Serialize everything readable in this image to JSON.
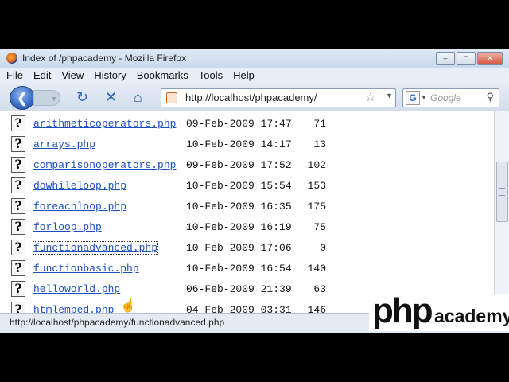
{
  "window": {
    "title": "Index of /phpacademy - Mozilla Firefox"
  },
  "menu": [
    "File",
    "Edit",
    "View",
    "History",
    "Bookmarks",
    "Tools",
    "Help"
  ],
  "nav": {
    "url": "http://localhost/phpacademy/",
    "search_placeholder": "Google",
    "search_engine_letter": "G"
  },
  "files": [
    {
      "name": "arithmeticoperators.php",
      "date": "09-Feb-2009 17:47",
      "size": "71"
    },
    {
      "name": "arrays.php",
      "date": "10-Feb-2009 14:17",
      "size": "13"
    },
    {
      "name": "comparisonoperators.php",
      "date": "09-Feb-2009 17:52",
      "size": "102"
    },
    {
      "name": "dowhileloop.php",
      "date": "10-Feb-2009 15:54",
      "size": "153"
    },
    {
      "name": "foreachloop.php",
      "date": "10-Feb-2009 16:35",
      "size": "175"
    },
    {
      "name": "forloop.php",
      "date": "10-Feb-2009 16:19",
      "size": "75"
    },
    {
      "name": "functionadvanced.php",
      "date": "10-Feb-2009 17:06",
      "size": "0"
    },
    {
      "name": "functionbasic.php",
      "date": "10-Feb-2009 16:54",
      "size": "140"
    },
    {
      "name": "helloworld.php",
      "date": "06-Feb-2009 21:39",
      "size": "63"
    },
    {
      "name": "htmlembed.php",
      "date": "04-Feb-2009 03:31",
      "size": "146"
    }
  ],
  "status": {
    "text": "http://localhost/phpacademy/functionadvanced.php"
  },
  "watermark": {
    "php": "php",
    "academy": "academy"
  },
  "icons": {
    "back": "back-arrow-icon",
    "forward": "forward-arrow-icon",
    "reload": "reload-icon",
    "stop": "stop-icon",
    "home": "home-icon",
    "bookmark": "star-icon",
    "search": "magnifier-icon",
    "file": "unknown-file-icon"
  }
}
